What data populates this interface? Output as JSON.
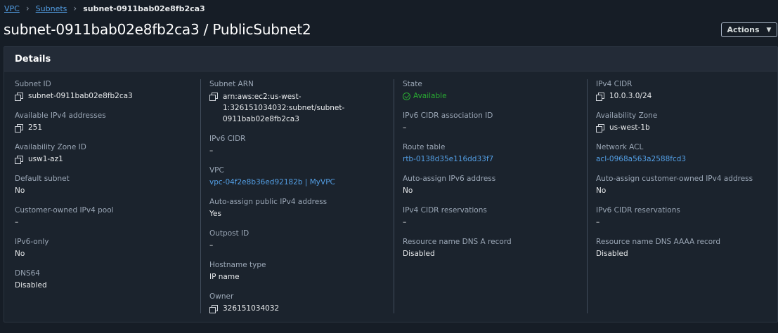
{
  "breadcrumb": {
    "vpc": "VPC",
    "subnets": "Subnets",
    "current": "subnet-0911bab02e8fb2ca3"
  },
  "title": "subnet-0911bab02e8fb2ca3 / PublicSubnet2",
  "actions": {
    "label": "Actions"
  },
  "details": {
    "header": "Details",
    "subnet_id": {
      "label": "Subnet ID",
      "value": "subnet-0911bab02e8fb2ca3"
    },
    "available_ipv4": {
      "label": "Available IPv4 addresses",
      "value": "251"
    },
    "az_id": {
      "label": "Availability Zone ID",
      "value": "usw1-az1"
    },
    "default_subnet": {
      "label": "Default subnet",
      "value": "No"
    },
    "customer_owned_pool": {
      "label": "Customer-owned IPv4 pool",
      "value": "–"
    },
    "ipv6_only": {
      "label": "IPv6-only",
      "value": "No"
    },
    "dns64": {
      "label": "DNS64",
      "value": "Disabled"
    },
    "subnet_arn": {
      "label": "Subnet ARN",
      "value": "arn:aws:ec2:us-west-1:326151034032:subnet/subnet-0911bab02e8fb2ca3"
    },
    "ipv6_cidr": {
      "label": "IPv6 CIDR",
      "value": "–"
    },
    "vpc": {
      "label": "VPC",
      "value": "vpc-04f2e8b36ed92182b | MyVPC"
    },
    "auto_public_ipv4": {
      "label": "Auto-assign public IPv4 address",
      "value": "Yes"
    },
    "outpost_id": {
      "label": "Outpost ID",
      "value": "–"
    },
    "hostname_type": {
      "label": "Hostname type",
      "value": "IP name"
    },
    "owner": {
      "label": "Owner",
      "value": "326151034032"
    },
    "state": {
      "label": "State",
      "value": "Available"
    },
    "ipv6_assoc_id": {
      "label": "IPv6 CIDR association ID",
      "value": "–"
    },
    "route_table": {
      "label": "Route table",
      "value": "rtb-0138d35e116dd33f7"
    },
    "auto_ipv6": {
      "label": "Auto-assign IPv6 address",
      "value": "No"
    },
    "ipv4_reservations": {
      "label": "IPv4 CIDR reservations",
      "value": "–"
    },
    "dns_a": {
      "label": "Resource name DNS A record",
      "value": "Disabled"
    },
    "ipv4_cidr": {
      "label": "IPv4 CIDR",
      "value": "10.0.3.0/24"
    },
    "az": {
      "label": "Availability Zone",
      "value": "us-west-1b"
    },
    "nacl": {
      "label": "Network ACL",
      "value": "acl-0968a563a2588fcd3"
    },
    "auto_customer_ipv4": {
      "label": "Auto-assign customer-owned IPv4 address",
      "value": "No"
    },
    "ipv6_reservations": {
      "label": "IPv6 CIDR reservations",
      "value": "–"
    },
    "dns_aaaa": {
      "label": "Resource name DNS AAAA record",
      "value": "Disabled"
    }
  }
}
